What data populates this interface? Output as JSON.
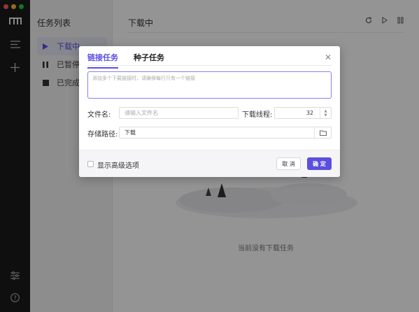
{
  "sidebar": {
    "traffic_colors": [
      "#fe5f57",
      "#febc2e",
      "#28c840"
    ]
  },
  "task_list": {
    "title": "任务列表",
    "items": [
      {
        "label": "下载中",
        "icon": "play-icon",
        "active": true
      },
      {
        "label": "已暂停",
        "icon": "pause-icon",
        "active": false
      },
      {
        "label": "已完成",
        "icon": "stop-icon",
        "active": false
      }
    ]
  },
  "main": {
    "title": "下载中",
    "toolbar_icons": [
      "refresh-icon",
      "play-icon",
      "pause-icon"
    ],
    "empty_text": "当前没有下载任务"
  },
  "dialog": {
    "tabs": [
      {
        "label": "链接任务",
        "active": true
      },
      {
        "label": "种子任务",
        "active": false
      }
    ],
    "url_placeholder": "添加多个下载链接时，请确保每行只有一个链接",
    "filename_label": "文件名:",
    "filename_placeholder": "请输入文件名",
    "threads_label": "下载线程:",
    "threads_value": "32",
    "path_label": "存储路径:",
    "path_value": "下载",
    "advanced_label": "显示高级选项",
    "cancel_label": "取 消",
    "ok_label": "确 定"
  },
  "colors": {
    "accent": "#5b4fe0",
    "rail_bg": "#1a1a1d"
  }
}
